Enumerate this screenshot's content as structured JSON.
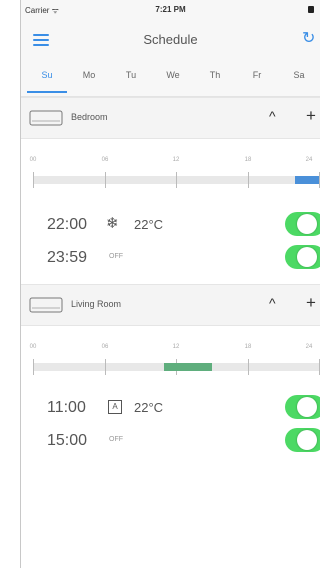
{
  "status": {
    "carrier": "Carrier ᯤ",
    "time": "7:21 PM"
  },
  "nav": {
    "title": "Schedule",
    "menu_icon": "menu-icon",
    "refresh_icon": "refresh-icon"
  },
  "days": [
    "Su",
    "Mo",
    "Tu",
    "We",
    "Th",
    "Fr",
    "Sa"
  ],
  "active_day": "Su",
  "rooms": [
    {
      "name": "Bedroom",
      "device_icon": "wall-ac-unit-icon",
      "timeline": {
        "tick_labels": [
          "00",
          "06",
          "12",
          "18",
          "24"
        ],
        "segment_hours": [
          22,
          24
        ],
        "segment_color": "#4a90d9"
      },
      "schedules": [
        {
          "time": "22:00",
          "mode_icon": "snowflake-icon",
          "mode_glyph": "❄",
          "temp": "22°C",
          "enabled": true
        },
        {
          "time": "23:59",
          "off_label": "OFF",
          "enabled": true
        }
      ]
    },
    {
      "name": "Living Room",
      "device_icon": "wall-ac-unit-icon",
      "timeline": {
        "tick_labels": [
          "00",
          "06",
          "12",
          "18",
          "24"
        ],
        "segment_hours": [
          11,
          15
        ],
        "segment_color": "#5fae7d"
      },
      "schedules": [
        {
          "time": "11:00",
          "mode_icon": "auto-mode-icon",
          "mode_glyph": "A",
          "temp": "22°C",
          "enabled": true
        },
        {
          "time": "15:00",
          "off_label": "OFF",
          "enabled": true
        }
      ]
    }
  ],
  "colors": {
    "accent": "#3a8ee6",
    "toggle_on": "#4cd964"
  }
}
